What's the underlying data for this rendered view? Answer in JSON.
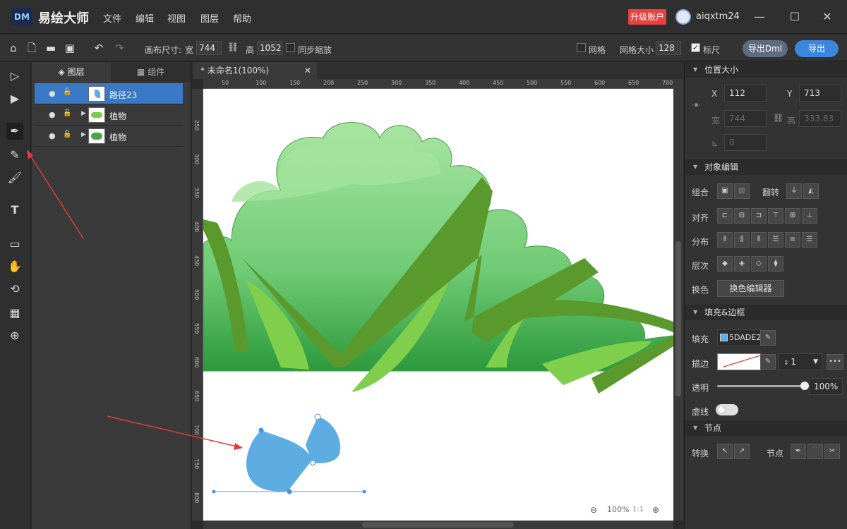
{
  "app": {
    "logo": "DM",
    "name": "易绘大师",
    "menus": [
      "文件",
      "编辑",
      "视图",
      "图层",
      "帮助"
    ],
    "upgrade_label": "升级账户",
    "username": "aiqxtm24",
    "window_controls": {
      "minimize": "—",
      "maximize": "☐",
      "close": "✕"
    }
  },
  "toolbar": {
    "canvas_size_label": "画布尺寸:",
    "width_label": "宽",
    "width_value": "744",
    "height_label": "高",
    "height_value": "1052",
    "sync_scale_label": "同步缩放",
    "grid_label": "网格",
    "grid_size_label": "网格大小",
    "grid_size_value": "128",
    "ruler_label": "标尺",
    "ruler_checked": true,
    "export_dml_label": "导出Dml",
    "export_label": "导出"
  },
  "tools": [
    "select-arrow",
    "direct-select",
    "pen",
    "pen-edit",
    "brush",
    "text",
    "rectangle",
    "hand",
    "rotate",
    "gradient",
    "zoom"
  ],
  "layers_panel": {
    "tabs": [
      "图层",
      "组件"
    ],
    "layers": [
      {
        "name": "路径23",
        "selected": true,
        "expandable": false
      },
      {
        "name": "植物",
        "selected": false,
        "expandable": true
      },
      {
        "name": "植物",
        "selected": false,
        "expandable": true
      }
    ]
  },
  "document": {
    "tab_title": "* 未命名1(100%)",
    "zoom_label": "100%",
    "zoom_ratio": "1:1",
    "ruler_h": [
      "50",
      "100",
      "150",
      "200",
      "250",
      "300",
      "350",
      "400",
      "450",
      "500",
      "550",
      "600",
      "650",
      "700"
    ],
    "ruler_v": [
      "250",
      "300",
      "350",
      "400",
      "450",
      "500",
      "550",
      "600",
      "650",
      "700",
      "750",
      "800"
    ]
  },
  "props": {
    "position_section": "位置大小",
    "x_label": "X",
    "x_value": "112",
    "y_label": "Y",
    "y_value": "713",
    "w_label": "宽",
    "w_value": "744",
    "h_label": "高",
    "h_value": "333.83",
    "angle_value": "0",
    "object_section": "对象编辑",
    "group_label": "组合",
    "flip_label": "翻转",
    "align_label": "对齐",
    "distribute_label": "分布",
    "order_label": "层次",
    "recolor_label": "换色",
    "recolor_button": "换色编辑器",
    "fill_section": "填充&边框",
    "fill_label": "填充",
    "fill_value": "5DADE2",
    "fill_color": "#5DADE2",
    "stroke_label": "描边",
    "stroke_width": "1",
    "opacity_label": "透明",
    "opacity_value": "100%",
    "opacity": 1.0,
    "dash_label": "虚线",
    "node_section": "节点",
    "convert_label": "转换",
    "node_label": "节点"
  }
}
